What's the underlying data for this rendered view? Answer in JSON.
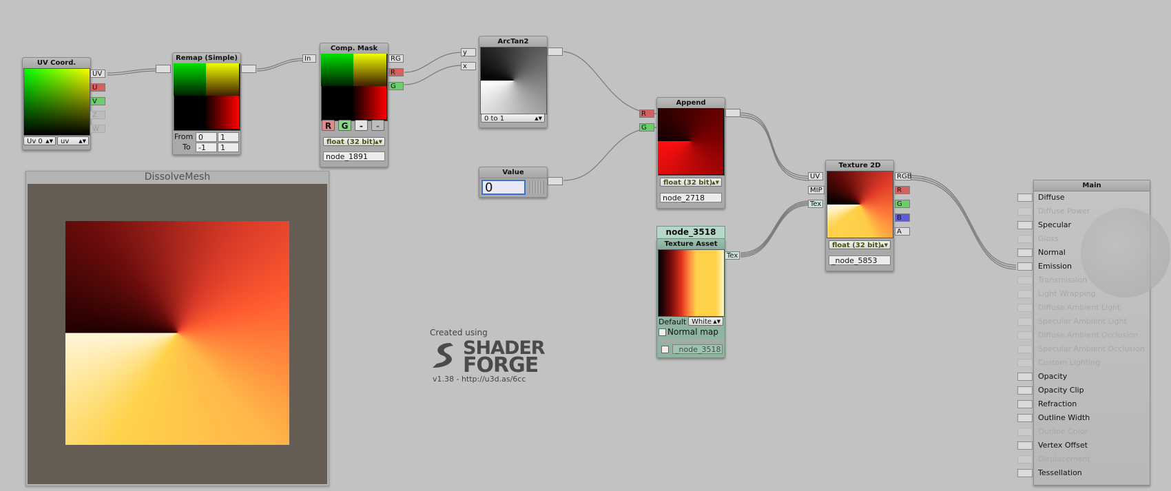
{
  "nodes": {
    "uv": {
      "title": "UV Coord.",
      "ports": [
        "UV",
        "U",
        "V",
        "Z",
        "W"
      ],
      "channel": "Uv 0",
      "mode": "uv"
    },
    "remap": {
      "title": "Remap (Simple)",
      "from_label": "From",
      "to_label": "To",
      "from_a": "0",
      "from_b": "1",
      "to_a": "-1",
      "to_b": "1"
    },
    "comp_mask": {
      "title": "Comp. Mask",
      "in_port": "In",
      "ports": [
        "RG",
        "R",
        "G"
      ],
      "buttons": [
        "R",
        "G",
        "-",
        "-"
      ],
      "precision": "float (32 bit)",
      "name": "node_1891"
    },
    "arctan": {
      "title": "ArcTan2",
      "in_y": "y",
      "in_x": "x",
      "mode": "0 to 1"
    },
    "value": {
      "title": "Value",
      "value": "0"
    },
    "append": {
      "title": "Append",
      "in_r": "R",
      "in_g": "G",
      "precision": "float (32 bit)",
      "name": "node_2718"
    },
    "tex_asset": {
      "name_header": "node_3518",
      "title": "Texture Asset",
      "out_port": "Tex",
      "default_label": "Default",
      "default_value": "White",
      "normal_map": "Normal map",
      "node_field": "_node_3518"
    },
    "tex2d": {
      "title": "Texture 2D",
      "in_ports": [
        "UV",
        "MIP",
        "Tex"
      ],
      "out_ports": [
        "RGB",
        "R",
        "G",
        "B",
        "A"
      ],
      "precision": "float (32 bit)",
      "name": "_node_5853"
    }
  },
  "preview_panel": {
    "title": "DissolveMesh"
  },
  "branding": {
    "created": "Created using",
    "word1": "SHADER",
    "word2": "FORGE",
    "version": "v1.38 - http://u3d.as/6cc"
  },
  "main": {
    "title": "Main",
    "inputs": [
      {
        "label": "Diffuse",
        "enabled": true
      },
      {
        "label": "Diffuse Power",
        "enabled": false
      },
      {
        "label": "Specular",
        "enabled": true
      },
      {
        "label": "Gloss",
        "enabled": false
      },
      {
        "label": "Normal",
        "enabled": true
      },
      {
        "label": "Emission",
        "enabled": true
      },
      {
        "label": "Transmission",
        "enabled": false
      },
      {
        "label": "Light Wrapping",
        "enabled": false
      },
      {
        "label": "Diffuse Ambient Light",
        "enabled": false
      },
      {
        "label": "Specular Ambient Light",
        "enabled": false
      },
      {
        "label": "Diffuse Ambient Occlusion",
        "enabled": false
      },
      {
        "label": "Specular Ambient Occlusion",
        "enabled": false
      },
      {
        "label": "Custom Lighting",
        "enabled": false
      },
      {
        "label": "Opacity",
        "enabled": true
      },
      {
        "label": "Opacity Clip",
        "enabled": true
      },
      {
        "label": "Refraction",
        "enabled": true
      },
      {
        "label": "Outline Width",
        "enabled": true
      },
      {
        "label": "Outline Color",
        "enabled": false
      },
      {
        "label": "Vertex Offset",
        "enabled": true
      },
      {
        "label": "Displacement",
        "enabled": false
      },
      {
        "label": "Tessellation",
        "enabled": true
      }
    ]
  },
  "colors": {
    "canvas": "#c2c2c2",
    "port_r": "#d56060",
    "port_g": "#6ccd6c",
    "port_b": "#5d5dd6",
    "preview_bg": "#655d54"
  }
}
